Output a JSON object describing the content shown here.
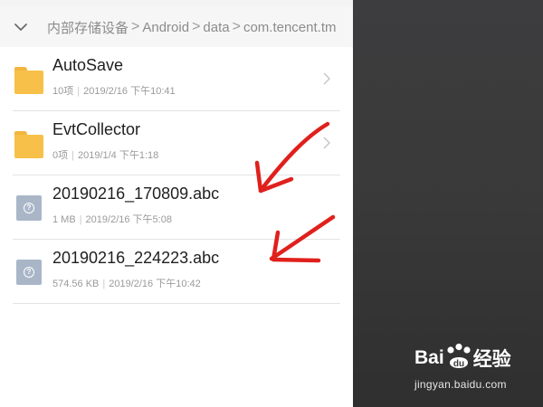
{
  "breadcrumb": {
    "items": [
      "内部存储设备",
      "Android",
      "data",
      "com.tencent.tm"
    ],
    "separator": ">"
  },
  "files": [
    {
      "name": "AutoSave",
      "type": "folder",
      "size": "10项",
      "date": "2019/2/16 下午10:41"
    },
    {
      "name": "EvtCollector",
      "type": "folder",
      "size": "0项",
      "date": "2019/1/4 下午1:18"
    },
    {
      "name": "20190216_170809.abc",
      "type": "file",
      "size": "1 MB",
      "date": "2019/2/16 下午5:08"
    },
    {
      "name": "20190216_224223.abc",
      "type": "file",
      "size": "574.56 KB",
      "date": "2019/2/16 下午10:42"
    }
  ],
  "meta_separator": "|",
  "watermark": {
    "brand_left": "Bai",
    "brand_paw": "du",
    "brand_right": "经验",
    "url": "jingyan.baidu.com"
  },
  "colors": {
    "folder": "#f7c048",
    "file_icon": "#a9b6c8",
    "annotation": "#e0201c"
  }
}
